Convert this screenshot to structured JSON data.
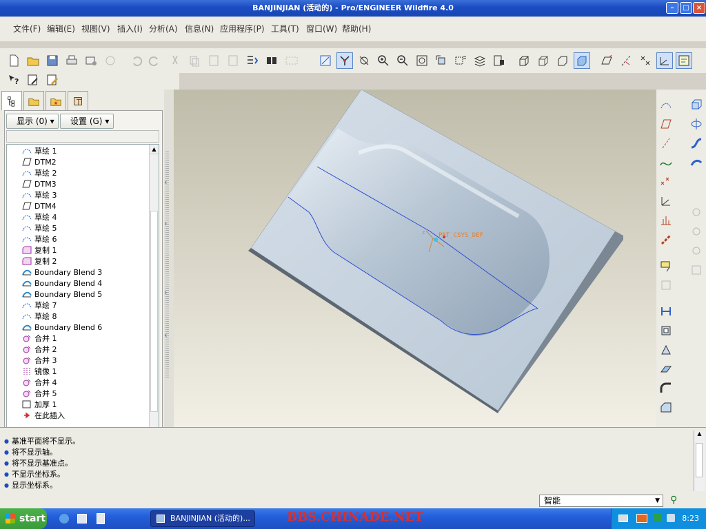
{
  "window": {
    "title": "BANJINJIAN (活动的) - Pro/ENGINEER Wildfire 4.0"
  },
  "menu": [
    "文件(F)",
    "编辑(E)",
    "视图(V)",
    "插入(I)",
    "分析(A)",
    "信息(N)",
    "应用程序(P)",
    "工具(T)",
    "窗口(W)",
    "帮助(H)"
  ],
  "nav": {
    "show_label": "显示 (0)",
    "settings_label": "设置 (G)",
    "tree": [
      {
        "label": "草绘 1",
        "icon": "sketch"
      },
      {
        "label": "DTM2",
        "icon": "datum-plane"
      },
      {
        "label": "草绘 2",
        "icon": "sketch"
      },
      {
        "label": "DTM3",
        "icon": "datum-plane"
      },
      {
        "label": "草绘 3",
        "icon": "sketch"
      },
      {
        "label": "DTM4",
        "icon": "datum-plane"
      },
      {
        "label": "草绘 4",
        "icon": "sketch"
      },
      {
        "label": "草绘 5",
        "icon": "sketch"
      },
      {
        "label": "草绘 6",
        "icon": "sketch"
      },
      {
        "label": "复制 1",
        "icon": "copy"
      },
      {
        "label": "复制 2",
        "icon": "copy"
      },
      {
        "label": "Boundary Blend 3",
        "icon": "boundary-blend"
      },
      {
        "label": "Boundary Blend 4",
        "icon": "boundary-blend"
      },
      {
        "label": "Boundary Blend 5",
        "icon": "boundary-blend"
      },
      {
        "label": "草绘 7",
        "icon": "sketch"
      },
      {
        "label": "草绘 8",
        "icon": "sketch"
      },
      {
        "label": "Boundary Blend 6",
        "icon": "boundary-blend"
      },
      {
        "label": "合并 1",
        "icon": "merge"
      },
      {
        "label": "合并 2",
        "icon": "merge"
      },
      {
        "label": "合并 3",
        "icon": "merge"
      },
      {
        "label": "镜像 1",
        "icon": "mirror"
      },
      {
        "label": "合并 4",
        "icon": "merge"
      },
      {
        "label": "合并 5",
        "icon": "merge"
      },
      {
        "label": "加厚 1",
        "icon": "thicken"
      },
      {
        "label": "在此插入",
        "icon": "insert-here"
      }
    ]
  },
  "viewport": {
    "csys_label": "PRT_CSYS_DEF"
  },
  "messages": [
    "基准平面将不显示。",
    "将不显示轴。",
    "将不显示基准点。",
    "不显示坐标系。",
    "显示坐标系。"
  ],
  "status": {
    "filter": "智能"
  },
  "taskbar": {
    "start": "start",
    "task": "BANJINJIAN (活动的)...",
    "watermark": "BBS.CHINADE.NET",
    "clock": "8:23"
  },
  "colors": {
    "titlebar": "#1b4cc2",
    "model": "#c3d1de",
    "curve": "#2f4fd0",
    "watermark": "#d83030"
  }
}
